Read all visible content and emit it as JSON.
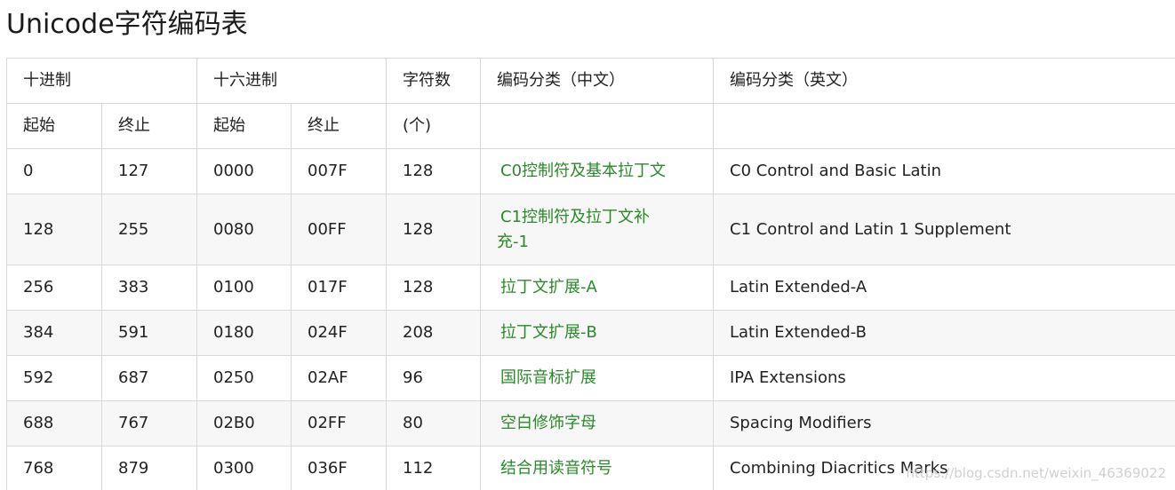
{
  "title": "Unicode字符编码表",
  "header": {
    "decimal": "十进制",
    "hex": "十六进制",
    "count": "字符数",
    "category_cn": "编码分类（中文）",
    "category_en": "编码分类（英文）",
    "start": "起始",
    "end": "终止",
    "count_unit": "(个)"
  },
  "rows": [
    {
      "dec_start": "0",
      "dec_end": "127",
      "hex_start": "0000",
      "hex_end": "007F",
      "count": "128",
      "cn": "C0控制符及基本拉丁文",
      "en": "C0 Control and Basic Latin"
    },
    {
      "dec_start": "128",
      "dec_end": "255",
      "hex_start": "0080",
      "hex_end": "00FF",
      "count": "128",
      "cn": "C1控制符及拉丁文补充-1",
      "en": "C1 Control and Latin 1 Supplement"
    },
    {
      "dec_start": "256",
      "dec_end": "383",
      "hex_start": "0100",
      "hex_end": "017F",
      "count": "128",
      "cn": "拉丁文扩展-A",
      "en": "Latin Extended-A"
    },
    {
      "dec_start": "384",
      "dec_end": "591",
      "hex_start": "0180",
      "hex_end": "024F",
      "count": "208",
      "cn": "拉丁文扩展-B",
      "en": "Latin Extended-B"
    },
    {
      "dec_start": "592",
      "dec_end": "687",
      "hex_start": "0250",
      "hex_end": "02AF",
      "count": "96",
      "cn": "国际音标扩展",
      "en": "IPA Extensions"
    },
    {
      "dec_start": "688",
      "dec_end": "767",
      "hex_start": "02B0",
      "hex_end": "02FF",
      "count": "80",
      "cn": "空白修饰字母",
      "en": "Spacing Modifiers"
    },
    {
      "dec_start": "768",
      "dec_end": "879",
      "hex_start": "0300",
      "hex_end": "036F",
      "count": "112",
      "cn": "结合用读音符号",
      "en": "Combining Diacritics Marks"
    }
  ],
  "watermark": "https://blog.csdn.net/weixin_46369022",
  "colors": {
    "link_green": "#2a8a2a",
    "border": "#d8d8d8",
    "stripe": "#f7f7f7"
  }
}
